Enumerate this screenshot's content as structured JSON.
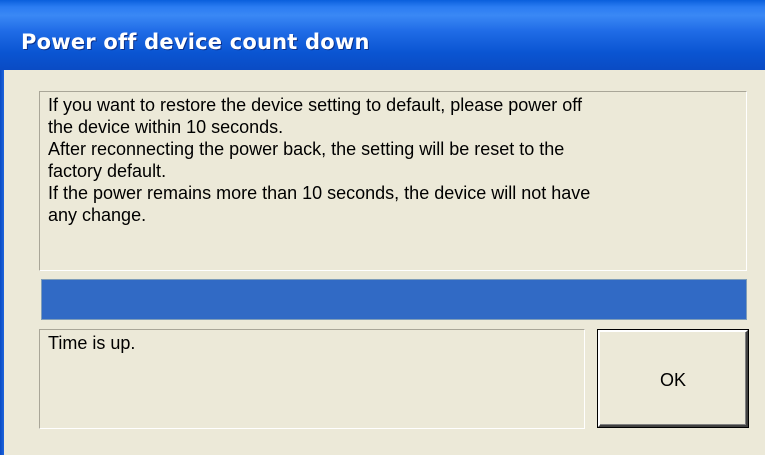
{
  "window": {
    "title": "Power off device count down"
  },
  "message": {
    "text": "If you want to restore the device setting to default, please power off\nthe device within 10 seconds.\nAfter reconnecting the power back, the setting will be reset to the\nfactory default.\nIf the power remains more than 10 seconds, the device will not have\nany change."
  },
  "progress": {
    "fraction": 1.0
  },
  "status": {
    "text": "Time is up."
  },
  "buttons": {
    "ok_label": "OK"
  },
  "colors": {
    "titlebar": "#0a55d2",
    "progress_fill": "#316ac5",
    "face": "#ece9d8"
  }
}
